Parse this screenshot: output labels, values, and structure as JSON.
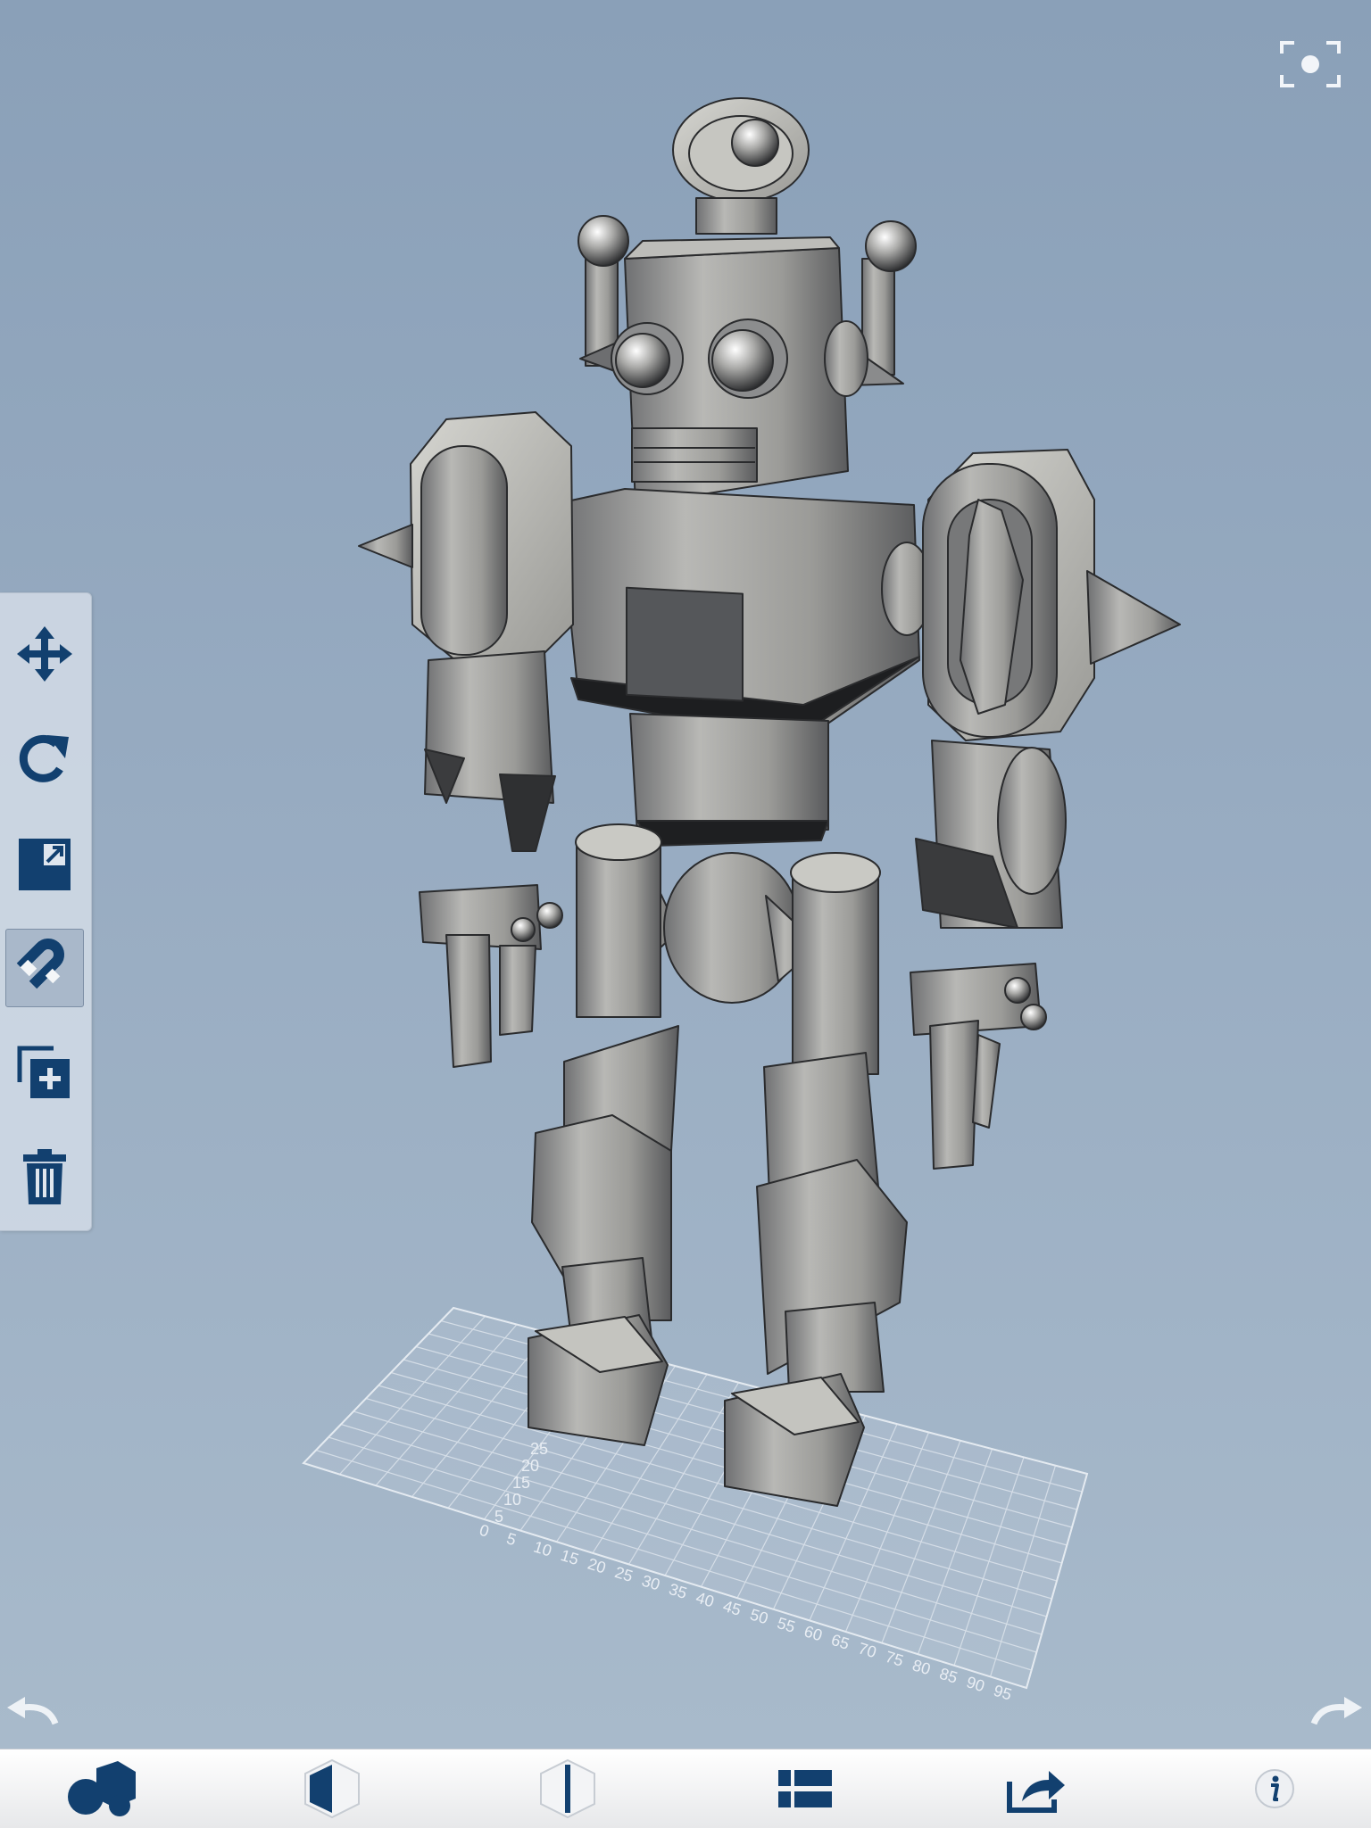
{
  "viewer": {
    "background_top": "#8aa0b8",
    "background_bottom": "#a8bacb",
    "accent": "#12406f",
    "focus_icon": "focus-frame-icon"
  },
  "grid": {
    "x_ticks": [
      "0",
      "5",
      "10",
      "15",
      "20",
      "25",
      "30",
      "35",
      "40",
      "45",
      "50",
      "55",
      "60",
      "65",
      "70",
      "75",
      "80",
      "85",
      "90",
      "95"
    ],
    "y_ticks": [
      "5",
      "10",
      "15",
      "20",
      "25"
    ]
  },
  "toolbar": {
    "tools": [
      {
        "name": "move",
        "icon": "move-arrows-icon",
        "active": false
      },
      {
        "name": "rotate",
        "icon": "rotate-icon",
        "active": false
      },
      {
        "name": "scale",
        "icon": "scale-icon",
        "active": false
      },
      {
        "name": "snap",
        "icon": "magnet-icon",
        "active": true
      },
      {
        "name": "duplicate",
        "icon": "duplicate-icon",
        "active": false
      },
      {
        "name": "delete",
        "icon": "trash-icon",
        "active": false
      }
    ]
  },
  "history": {
    "undo_icon": "undo-arrow-icon",
    "redo_icon": "redo-arrow-icon"
  },
  "bottom_bar": {
    "items": [
      {
        "name": "primitives",
        "icon": "shapes-icon"
      },
      {
        "name": "shading",
        "icon": "half-cube-icon"
      },
      {
        "name": "split-view",
        "icon": "split-cube-icon"
      },
      {
        "name": "parts-list",
        "icon": "list-icon"
      },
      {
        "name": "share",
        "icon": "share-icon"
      },
      {
        "name": "info",
        "icon": "info-icon"
      }
    ]
  }
}
